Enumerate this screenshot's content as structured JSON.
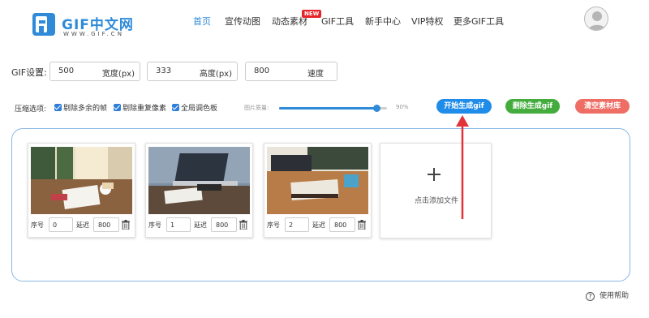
{
  "logo": {
    "title": "GIF中文网",
    "subtitle": "WWW.GIF.CN"
  },
  "nav": {
    "items": [
      {
        "label": "首页"
      },
      {
        "label": "宣传动图"
      },
      {
        "label": "动态素材"
      },
      {
        "label": "GIF工具"
      },
      {
        "label": "新手中心"
      },
      {
        "label": "VIP特权"
      },
      {
        "label": "更多GIF工具"
      }
    ],
    "active_index": 0,
    "badge": "NEW"
  },
  "settings": {
    "label": "GIF设置:",
    "width": {
      "value": "500",
      "unit": "宽度(px)"
    },
    "height": {
      "value": "333",
      "unit": "高度(px)"
    },
    "speed": {
      "value": "800",
      "unit": "速度"
    }
  },
  "compression": {
    "label": "压缩选项:",
    "options": [
      {
        "label": "剔除多余的帧",
        "checked": true
      },
      {
        "label": "剔除重复像素",
        "checked": true
      },
      {
        "label": "全局调色板",
        "checked": true
      }
    ],
    "quality_label": "图片质量:",
    "quality_value": "90%",
    "quality_percent": 90
  },
  "buttons": {
    "start": "开始生成gif",
    "delete": "删除生成gif",
    "clear": "清空素材库"
  },
  "frames": [
    {
      "index_label": "序号",
      "index": "0",
      "delay_label": "延迟",
      "delay": "800"
    },
    {
      "index_label": "序号",
      "index": "1",
      "delay_label": "延迟",
      "delay": "800"
    },
    {
      "index_label": "序号",
      "index": "2",
      "delay_label": "延迟",
      "delay": "800"
    }
  ],
  "add_file": {
    "label": "点击添加文件"
  },
  "help": {
    "label": "使用帮助"
  },
  "colors": {
    "accent": "#2f8ad8",
    "start": "#1f8ce9",
    "delete": "#43ac3d",
    "clear": "#ee6d64",
    "arrow": "#e2333a"
  }
}
